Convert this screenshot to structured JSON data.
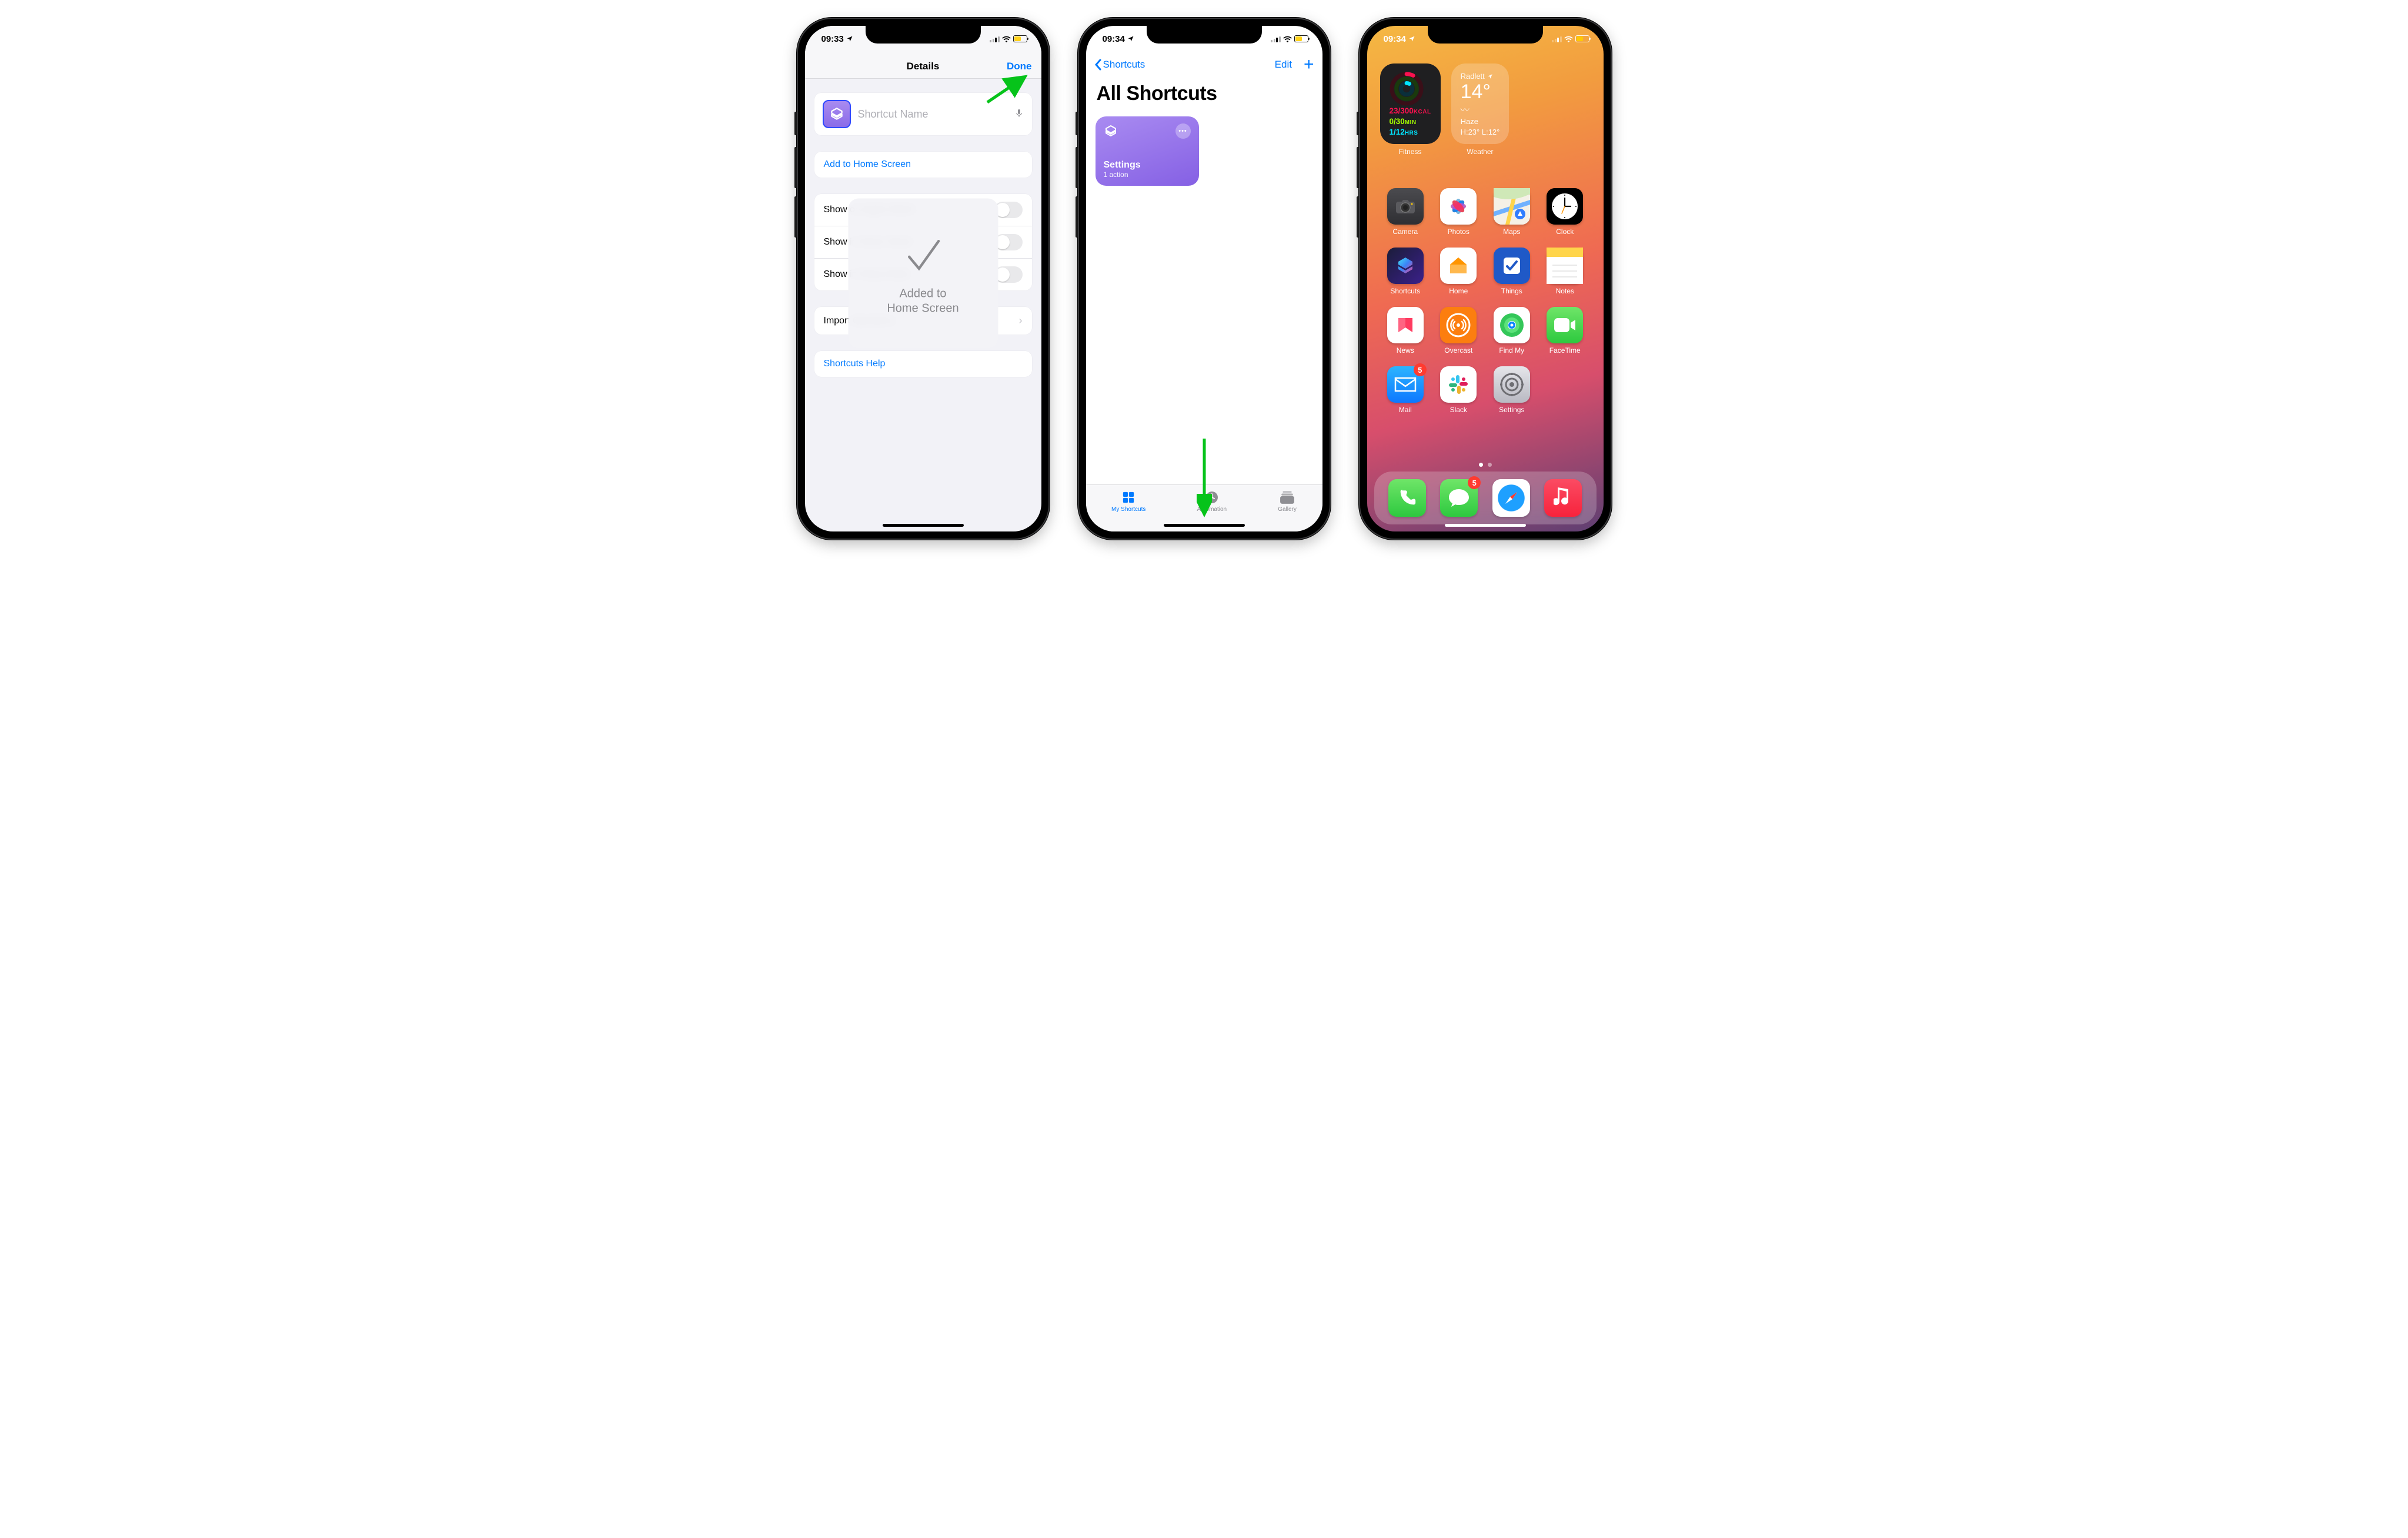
{
  "status": {
    "time1": "09:33",
    "time2": "09:34",
    "time3": "09:34"
  },
  "phone1": {
    "title": "Details",
    "done": "Done",
    "name_placeholder": "Shortcut Name",
    "add_home": "Add to Home Screen",
    "toggles": [
      "Show on Apple Watch",
      "Show in Share Sheet",
      "Show in Sleep Mode"
    ],
    "import": "Import Questions",
    "help": "Shortcuts Help",
    "overlay": "Added to\nHome Screen"
  },
  "phone2": {
    "back": "Shortcuts",
    "edit": "Edit",
    "title": "All Shortcuts",
    "card": {
      "name": "Settings",
      "sub": "1 action"
    },
    "tabs": [
      "My Shortcuts",
      "Automation",
      "Gallery"
    ]
  },
  "phone3": {
    "fitness": {
      "label": "Fitness",
      "move": "23/300",
      "move_u": "KCAL",
      "ex": "0/30",
      "ex_u": "MIN",
      "st": "1/12",
      "st_u": "HRS"
    },
    "weather": {
      "label": "Weather",
      "loc": "Radlett",
      "temp": "14°",
      "cond": "Haze",
      "hl": "H:23° L:12°"
    },
    "apps": [
      {
        "n": "Camera",
        "c": "ic-camera"
      },
      {
        "n": "Photos",
        "c": "ic-photos"
      },
      {
        "n": "Maps",
        "c": "ic-maps"
      },
      {
        "n": "Clock",
        "c": "ic-clock"
      },
      {
        "n": "Shortcuts",
        "c": "ic-shortcuts"
      },
      {
        "n": "Home",
        "c": "ic-home"
      },
      {
        "n": "Things",
        "c": "ic-things"
      },
      {
        "n": "Notes",
        "c": "ic-notes"
      },
      {
        "n": "News",
        "c": "ic-news"
      },
      {
        "n": "Overcast",
        "c": "ic-overcast"
      },
      {
        "n": "Find My",
        "c": "ic-findmy"
      },
      {
        "n": "FaceTime",
        "c": "ic-facetime"
      },
      {
        "n": "Mail",
        "c": "ic-mail",
        "badge": "5"
      },
      {
        "n": "Slack",
        "c": "ic-slack"
      },
      {
        "n": "Settings",
        "c": "ic-settings"
      }
    ],
    "dock": [
      {
        "n": "Phone",
        "c": "ic-phone"
      },
      {
        "n": "Messages",
        "c": "ic-msg",
        "badge": "5"
      },
      {
        "n": "Safari",
        "c": "ic-safari"
      },
      {
        "n": "Music",
        "c": "ic-music"
      }
    ]
  }
}
